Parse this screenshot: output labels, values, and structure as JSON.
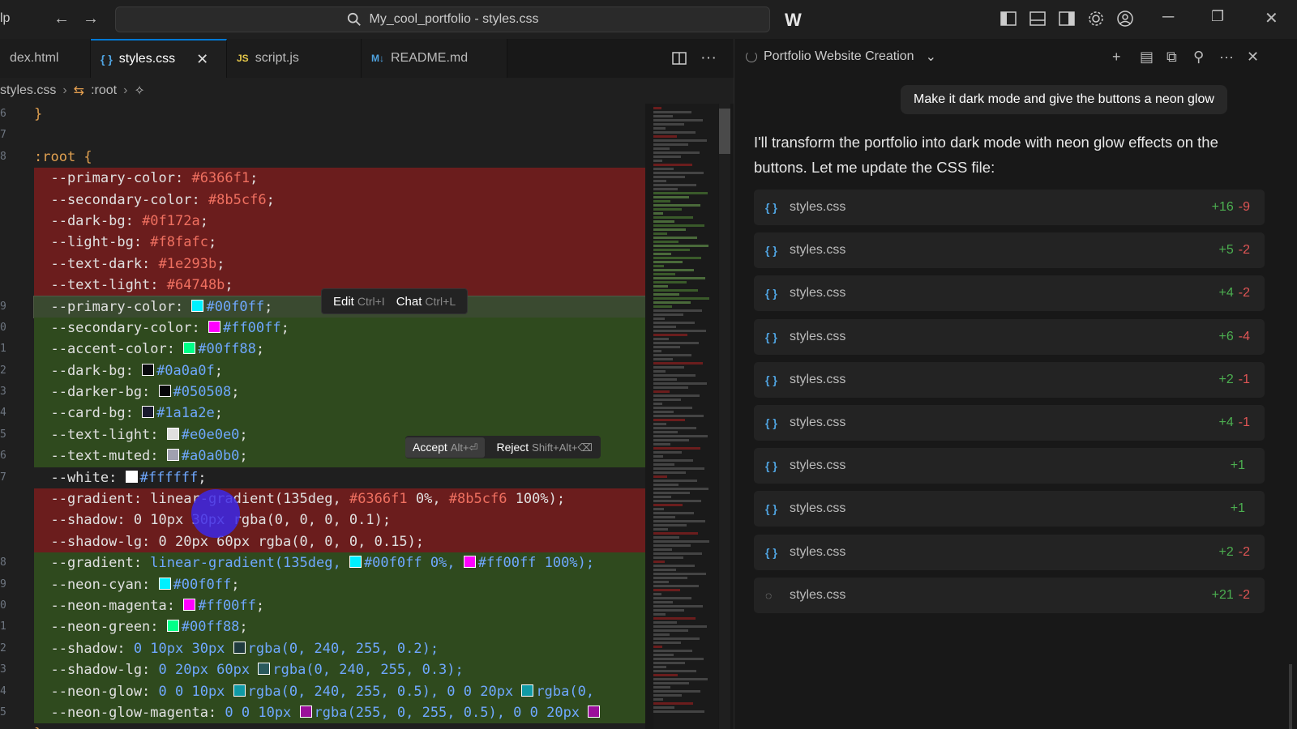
{
  "titlebar": {
    "app_fragment": "lp",
    "search_text": "My_cool_portfolio - styles.css"
  },
  "tabs": [
    {
      "label": "dex.html",
      "icon": "html-icon"
    },
    {
      "label": "styles.css",
      "icon": "{ }",
      "active": true
    },
    {
      "label": "script.js",
      "icon": "JS"
    },
    {
      "label": "README.md",
      "icon": "M↓"
    }
  ],
  "breadcrumb": {
    "file": "styles.css",
    "symbol": ":root"
  },
  "code_lines": [
    {
      "num": "6",
      "type": "normal",
      "html_key": "l0"
    },
    {
      "num": "7",
      "type": "normal",
      "html_key": "l1"
    },
    {
      "num": "8",
      "type": "normal",
      "html_key": "l2"
    },
    {
      "num": "",
      "type": "del",
      "html_key": "l3"
    },
    {
      "num": "",
      "type": "del",
      "html_key": "l4"
    },
    {
      "num": "",
      "type": "del",
      "html_key": "l5"
    },
    {
      "num": "",
      "type": "del",
      "html_key": "l6"
    },
    {
      "num": "",
      "type": "del",
      "html_key": "l7"
    },
    {
      "num": "",
      "type": "del",
      "html_key": "l8"
    },
    {
      "num": "9",
      "type": "add-active",
      "html_key": "l9"
    },
    {
      "num": "0",
      "type": "add",
      "html_key": "l10"
    },
    {
      "num": "1",
      "type": "add",
      "html_key": "l11"
    },
    {
      "num": "2",
      "type": "add",
      "html_key": "l12"
    },
    {
      "num": "3",
      "type": "add",
      "html_key": "l13"
    },
    {
      "num": "4",
      "type": "add",
      "html_key": "l14"
    },
    {
      "num": "5",
      "type": "add",
      "html_key": "l15"
    },
    {
      "num": "6",
      "type": "add",
      "html_key": "l16"
    },
    {
      "num": "7",
      "type": "normal",
      "html_key": "l17"
    },
    {
      "num": "",
      "type": "del",
      "html_key": "l18"
    },
    {
      "num": "",
      "type": "del",
      "html_key": "l19"
    },
    {
      "num": "",
      "type": "del",
      "html_key": "l20"
    },
    {
      "num": "8",
      "type": "add",
      "html_key": "l21"
    },
    {
      "num": "9",
      "type": "add",
      "html_key": "l22"
    },
    {
      "num": "0",
      "type": "add",
      "html_key": "l23"
    },
    {
      "num": "1",
      "type": "add",
      "html_key": "l24"
    },
    {
      "num": "2",
      "type": "add",
      "html_key": "l25"
    },
    {
      "num": "3",
      "type": "add",
      "html_key": "l26"
    },
    {
      "num": "4",
      "type": "add",
      "html_key": "l27"
    },
    {
      "num": "5",
      "type": "add",
      "html_key": "l28"
    },
    {
      "num": "",
      "type": "normal",
      "html_key": "l29"
    }
  ],
  "code": {
    "l0": [
      {
        "t": "}",
        "c": "c-sel"
      }
    ],
    "l1": [],
    "l2": [
      {
        "t": ":root",
        "c": "c-sel"
      },
      {
        "t": " {",
        "c": "c-sel"
      }
    ],
    "l3": [
      {
        "t": "  --primary-color: ",
        "c": "c-prop"
      },
      {
        "t": "#6366f1",
        "c": "c-val-red"
      },
      {
        "t": ";",
        "c": "c-prop"
      }
    ],
    "l4": [
      {
        "t": "  --secondary-color: ",
        "c": "c-prop"
      },
      {
        "t": "#8b5cf6",
        "c": "c-val-red"
      },
      {
        "t": ";",
        "c": "c-prop"
      }
    ],
    "l5": [
      {
        "t": "  --dark-bg: ",
        "c": "c-prop"
      },
      {
        "t": "#0f172a",
        "c": "c-val-red"
      },
      {
        "t": ";",
        "c": "c-prop"
      }
    ],
    "l6": [
      {
        "t": "  --light-bg: ",
        "c": "c-prop"
      },
      {
        "t": "#f8fafc",
        "c": "c-val-red"
      },
      {
        "t": ";",
        "c": "c-prop"
      }
    ],
    "l7": [
      {
        "t": "  --text-dark: ",
        "c": "c-prop"
      },
      {
        "t": "#1e293b",
        "c": "c-val-red"
      },
      {
        "t": ";",
        "c": "c-prop"
      }
    ],
    "l8": [
      {
        "t": "  --text-light: ",
        "c": "c-prop"
      },
      {
        "t": "#64748b",
        "c": "c-val-red"
      },
      {
        "t": ";",
        "c": "c-prop"
      }
    ],
    "l9": [
      {
        "t": "  --primary-color: ",
        "c": "c-prop"
      },
      {
        "sw": "#00f0ff"
      },
      {
        "t": "#00f0ff",
        "c": "c-val-blue"
      },
      {
        "t": ";",
        "c": "c-prop"
      }
    ],
    "l10": [
      {
        "t": "  --secondary-color: ",
        "c": "c-prop"
      },
      {
        "sw": "#ff00ff"
      },
      {
        "t": "#ff00ff",
        "c": "c-val-blue"
      },
      {
        "t": ";",
        "c": "c-prop"
      }
    ],
    "l11": [
      {
        "t": "  --accent-color: ",
        "c": "c-prop"
      },
      {
        "sw": "#00ff88"
      },
      {
        "t": "#00ff88",
        "c": "c-val-blue"
      },
      {
        "t": ";",
        "c": "c-prop"
      }
    ],
    "l12": [
      {
        "t": "  --dark-bg: ",
        "c": "c-prop"
      },
      {
        "sw": "#0a0a0f"
      },
      {
        "t": "#0a0a0f",
        "c": "c-val-blue"
      },
      {
        "t": ";",
        "c": "c-prop"
      }
    ],
    "l13": [
      {
        "t": "  --darker-bg: ",
        "c": "c-prop"
      },
      {
        "sw": "#050508"
      },
      {
        "t": "#050508",
        "c": "c-val-blue"
      },
      {
        "t": ";",
        "c": "c-prop"
      }
    ],
    "l14": [
      {
        "t": "  --card-bg: ",
        "c": "c-prop"
      },
      {
        "sw": "#1a1a2e"
      },
      {
        "t": "#1a1a2e",
        "c": "c-val-blue"
      },
      {
        "t": ";",
        "c": "c-prop"
      }
    ],
    "l15": [
      {
        "t": "  --text-light: ",
        "c": "c-prop"
      },
      {
        "sw": "#e0e0e0"
      },
      {
        "t": "#e0e0e0",
        "c": "c-val-blue"
      },
      {
        "t": ";",
        "c": "c-prop"
      }
    ],
    "l16": [
      {
        "t": "  --text-muted: ",
        "c": "c-prop"
      },
      {
        "sw": "#a0a0b0"
      },
      {
        "t": "#a0a0b0",
        "c": "c-val-blue"
      },
      {
        "t": ";",
        "c": "c-prop"
      }
    ],
    "l17": [
      {
        "t": "  --white: ",
        "c": "c-prop"
      },
      {
        "sw": "#ffffff"
      },
      {
        "t": "#ffffff",
        "c": "c-val-blue"
      },
      {
        "t": ";",
        "c": "c-prop"
      }
    ],
    "l18": [
      {
        "t": "  --gradient: ",
        "c": "c-prop"
      },
      {
        "t": "linear-gradient",
        "c": "c-prop"
      },
      {
        "t": "(135deg, ",
        "c": "c-prop"
      },
      {
        "t": "#6366f1",
        "c": "c-val-red"
      },
      {
        "t": " 0%, ",
        "c": "c-prop"
      },
      {
        "t": "#8b5cf6",
        "c": "c-val-red"
      },
      {
        "t": " 100%);",
        "c": "c-prop"
      }
    ],
    "l19": [
      {
        "t": "  --shadow: 0 10px 30px rgba(0, 0, 0, 0.1);",
        "c": "c-prop"
      }
    ],
    "l20": [
      {
        "t": "  --shadow-lg: 0 20px 60px rgba(0, 0, 0, 0.15);",
        "c": "c-prop"
      }
    ],
    "l21": [
      {
        "t": "  --gradient: ",
        "c": "c-prop"
      },
      {
        "t": "linear-gradient(135deg, ",
        "c": "c-val-blue"
      },
      {
        "sw": "#00f0ff"
      },
      {
        "t": "#00f0ff 0%, ",
        "c": "c-val-blue"
      },
      {
        "sw": "#ff00ff"
      },
      {
        "t": "#ff00ff 100%);",
        "c": "c-val-blue"
      }
    ],
    "l22": [
      {
        "t": "  --neon-cyan: ",
        "c": "c-prop"
      },
      {
        "sw": "#00f0ff"
      },
      {
        "t": "#00f0ff",
        "c": "c-val-blue"
      },
      {
        "t": ";",
        "c": "c-prop"
      }
    ],
    "l23": [
      {
        "t": "  --neon-magenta: ",
        "c": "c-prop"
      },
      {
        "sw": "#ff00ff"
      },
      {
        "t": "#ff00ff",
        "c": "c-val-blue"
      },
      {
        "t": ";",
        "c": "c-prop"
      }
    ],
    "l24": [
      {
        "t": "  --neon-green: ",
        "c": "c-prop"
      },
      {
        "sw": "#00ff88"
      },
      {
        "t": "#00ff88",
        "c": "c-val-blue"
      },
      {
        "t": ";",
        "c": "c-prop"
      }
    ],
    "l25": [
      {
        "t": "  --shadow: ",
        "c": "c-prop"
      },
      {
        "t": "0 10px 30px ",
        "c": "c-val-blue"
      },
      {
        "sw": "#1f3a3d"
      },
      {
        "t": "rgba(0, 240, 255, 0.2);",
        "c": "c-val-blue"
      }
    ],
    "l26": [
      {
        "t": "  --shadow-lg: ",
        "c": "c-prop"
      },
      {
        "t": "0 20px 60px ",
        "c": "c-val-blue"
      },
      {
        "sw": "#2a5a5d"
      },
      {
        "t": "rgba(0, 240, 255, 0.3);",
        "c": "c-val-blue"
      }
    ],
    "l27": [
      {
        "t": "  --neon-glow: ",
        "c": "c-prop"
      },
      {
        "t": "0 0 10px ",
        "c": "c-val-blue"
      },
      {
        "sw": "#109aa5"
      },
      {
        "t": "rgba(0, 240, 255, 0.5), 0 0 20px ",
        "c": "c-val-blue"
      },
      {
        "sw": "#109aa5"
      },
      {
        "t": "rgba(0,",
        "c": "c-val-blue"
      }
    ],
    "l28": [
      {
        "t": "  --neon-glow-magenta: ",
        "c": "c-prop"
      },
      {
        "t": "0 0 10px ",
        "c": "c-val-blue"
      },
      {
        "sw": "#9a109a"
      },
      {
        "t": "rgba(255, 0, 255, 0.5), 0 0 20px ",
        "c": "c-val-blue"
      },
      {
        "sw": "#9a109a"
      }
    ],
    "l29": [
      {
        "t": "}",
        "c": "c-sel"
      }
    ]
  },
  "inline_hint": {
    "edit": "Edit",
    "edit_kb": "Ctrl+I",
    "chat": "Chat",
    "chat_kb": "Ctrl+L"
  },
  "diff_actions": {
    "accept": "Accept",
    "accept_kb": "Alt+⏎",
    "reject": "Reject",
    "reject_kb": "Shift+Alt+⌫"
  },
  "chat": {
    "title": "Portfolio Website Creation",
    "user_message": "Make it dark mode and give the buttons a neon glow",
    "assistant_message": "I'll transform the portfolio into dark mode with neon glow effects on the buttons. Let me update the CSS file:",
    "files": [
      {
        "name": "styles.css",
        "added": "+16",
        "removed": "-9"
      },
      {
        "name": "styles.css",
        "added": "+5",
        "removed": "-2"
      },
      {
        "name": "styles.css",
        "added": "+4",
        "removed": "-2"
      },
      {
        "name": "styles.css",
        "added": "+6",
        "removed": "-4"
      },
      {
        "name": "styles.css",
        "added": "+2",
        "removed": "-1"
      },
      {
        "name": "styles.css",
        "added": "+4",
        "removed": "-1"
      },
      {
        "name": "styles.css",
        "added": "+1",
        "removed": ""
      },
      {
        "name": "styles.css",
        "added": "+1",
        "removed": ""
      },
      {
        "name": "styles.css",
        "added": "+2",
        "removed": "-2"
      },
      {
        "name": "styles.css",
        "added": "+21",
        "removed": "-2",
        "loading": true
      }
    ]
  },
  "colors": {
    "accent": "#0078d4",
    "added": "#4caf50",
    "removed": "#e05555",
    "diff_add_bg": "#2f4a1e",
    "diff_del_bg": "#6b1d1d"
  }
}
